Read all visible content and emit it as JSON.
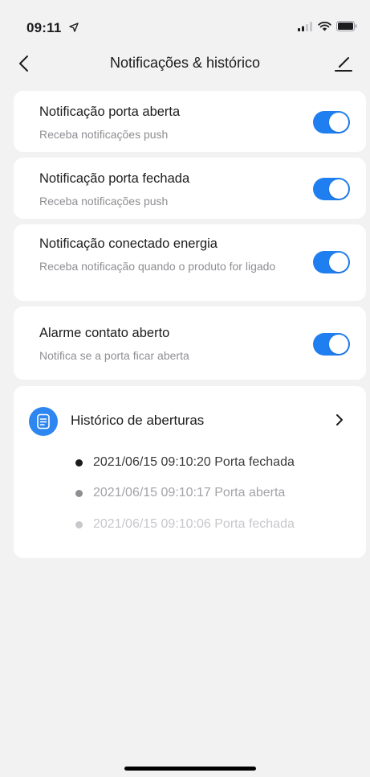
{
  "status_bar": {
    "time": "09:11"
  },
  "nav": {
    "title": "Notificações & histórico"
  },
  "settings": [
    {
      "title": "Notificação porta aberta",
      "subtitle": "Receba notificações push",
      "enabled": true
    },
    {
      "title": "Notificação porta fechada",
      "subtitle": "Receba notificações push",
      "enabled": true
    },
    {
      "title": "Notificação conectado energia",
      "subtitle": "Receba notificação quando o produto for ligado",
      "enabled": true
    },
    {
      "title": "Alarme contato aberto",
      "subtitle": "Notifica se a porta ficar aberta",
      "enabled": true
    }
  ],
  "history": {
    "title": "Histórico de aberturas",
    "entries": [
      {
        "text": "2021/06/15 09:10:20 Porta fechada",
        "color": "#3a3a3c",
        "dot": "#1c1c1e"
      },
      {
        "text": "2021/06/15 09:10:17 Porta aberta",
        "color": "#a3a3a8",
        "dot": "#8e8e93"
      },
      {
        "text": "2021/06/15 09:10:06 Porta fechada",
        "color": "#c7c7cc",
        "dot": "#c7c7cc"
      }
    ]
  },
  "colors": {
    "accent": "#1f7ef0",
    "background": "#f2f2f3"
  },
  "icons": [
    "location-arrow-icon",
    "signal-icon",
    "wifi-icon",
    "battery-icon",
    "back-chevron-icon",
    "edit-pencil-icon",
    "document-list-icon",
    "chevron-right-icon"
  ]
}
